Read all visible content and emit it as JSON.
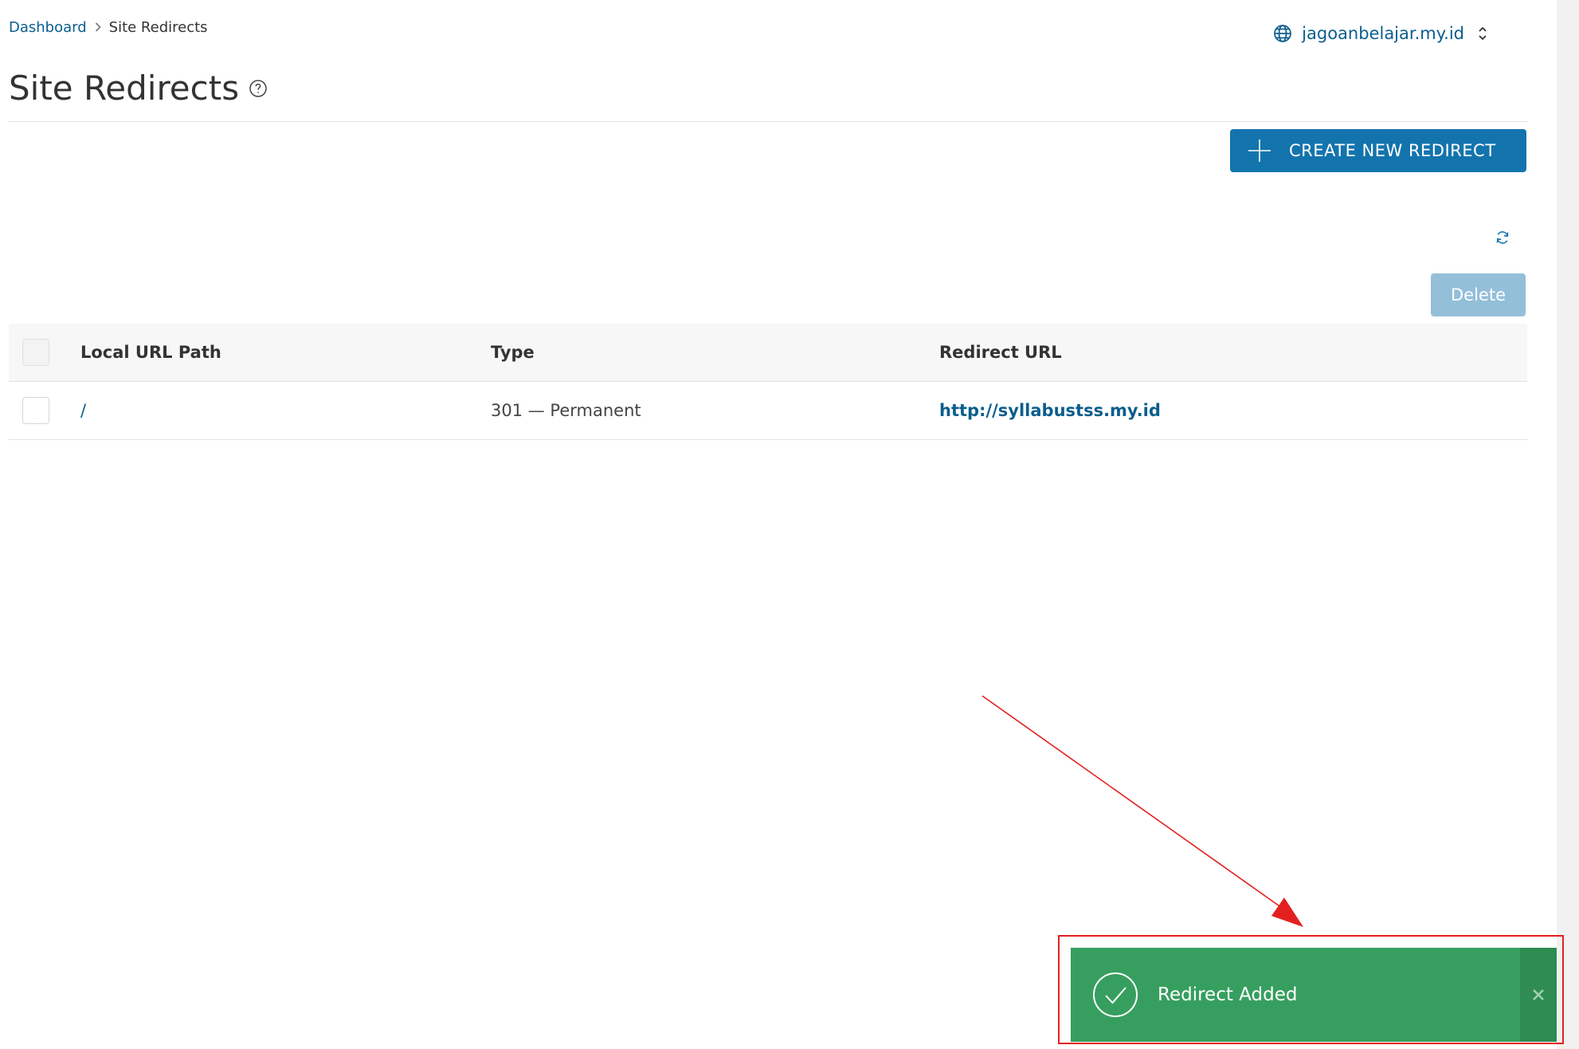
{
  "breadcrumb": {
    "home": "Dashboard",
    "current": "Site Redirects"
  },
  "site_selector": {
    "domain": "jagoanbelajar.my.id"
  },
  "page": {
    "title": "Site Redirects"
  },
  "toolbar": {
    "create_label": "CREATE NEW REDIRECT",
    "delete_label": "Delete"
  },
  "table": {
    "headers": {
      "path": "Local URL Path",
      "type": "Type",
      "url": "Redirect URL"
    },
    "rows": [
      {
        "path": "/",
        "type": "301 — Permanent",
        "url": "http://syllabustss.my.id"
      }
    ]
  },
  "toast": {
    "message": "Redirect Added"
  },
  "colors": {
    "brand": "#1374ad",
    "link": "#0b5e8c",
    "success": "#369f5f",
    "annotation": "#e32020"
  }
}
